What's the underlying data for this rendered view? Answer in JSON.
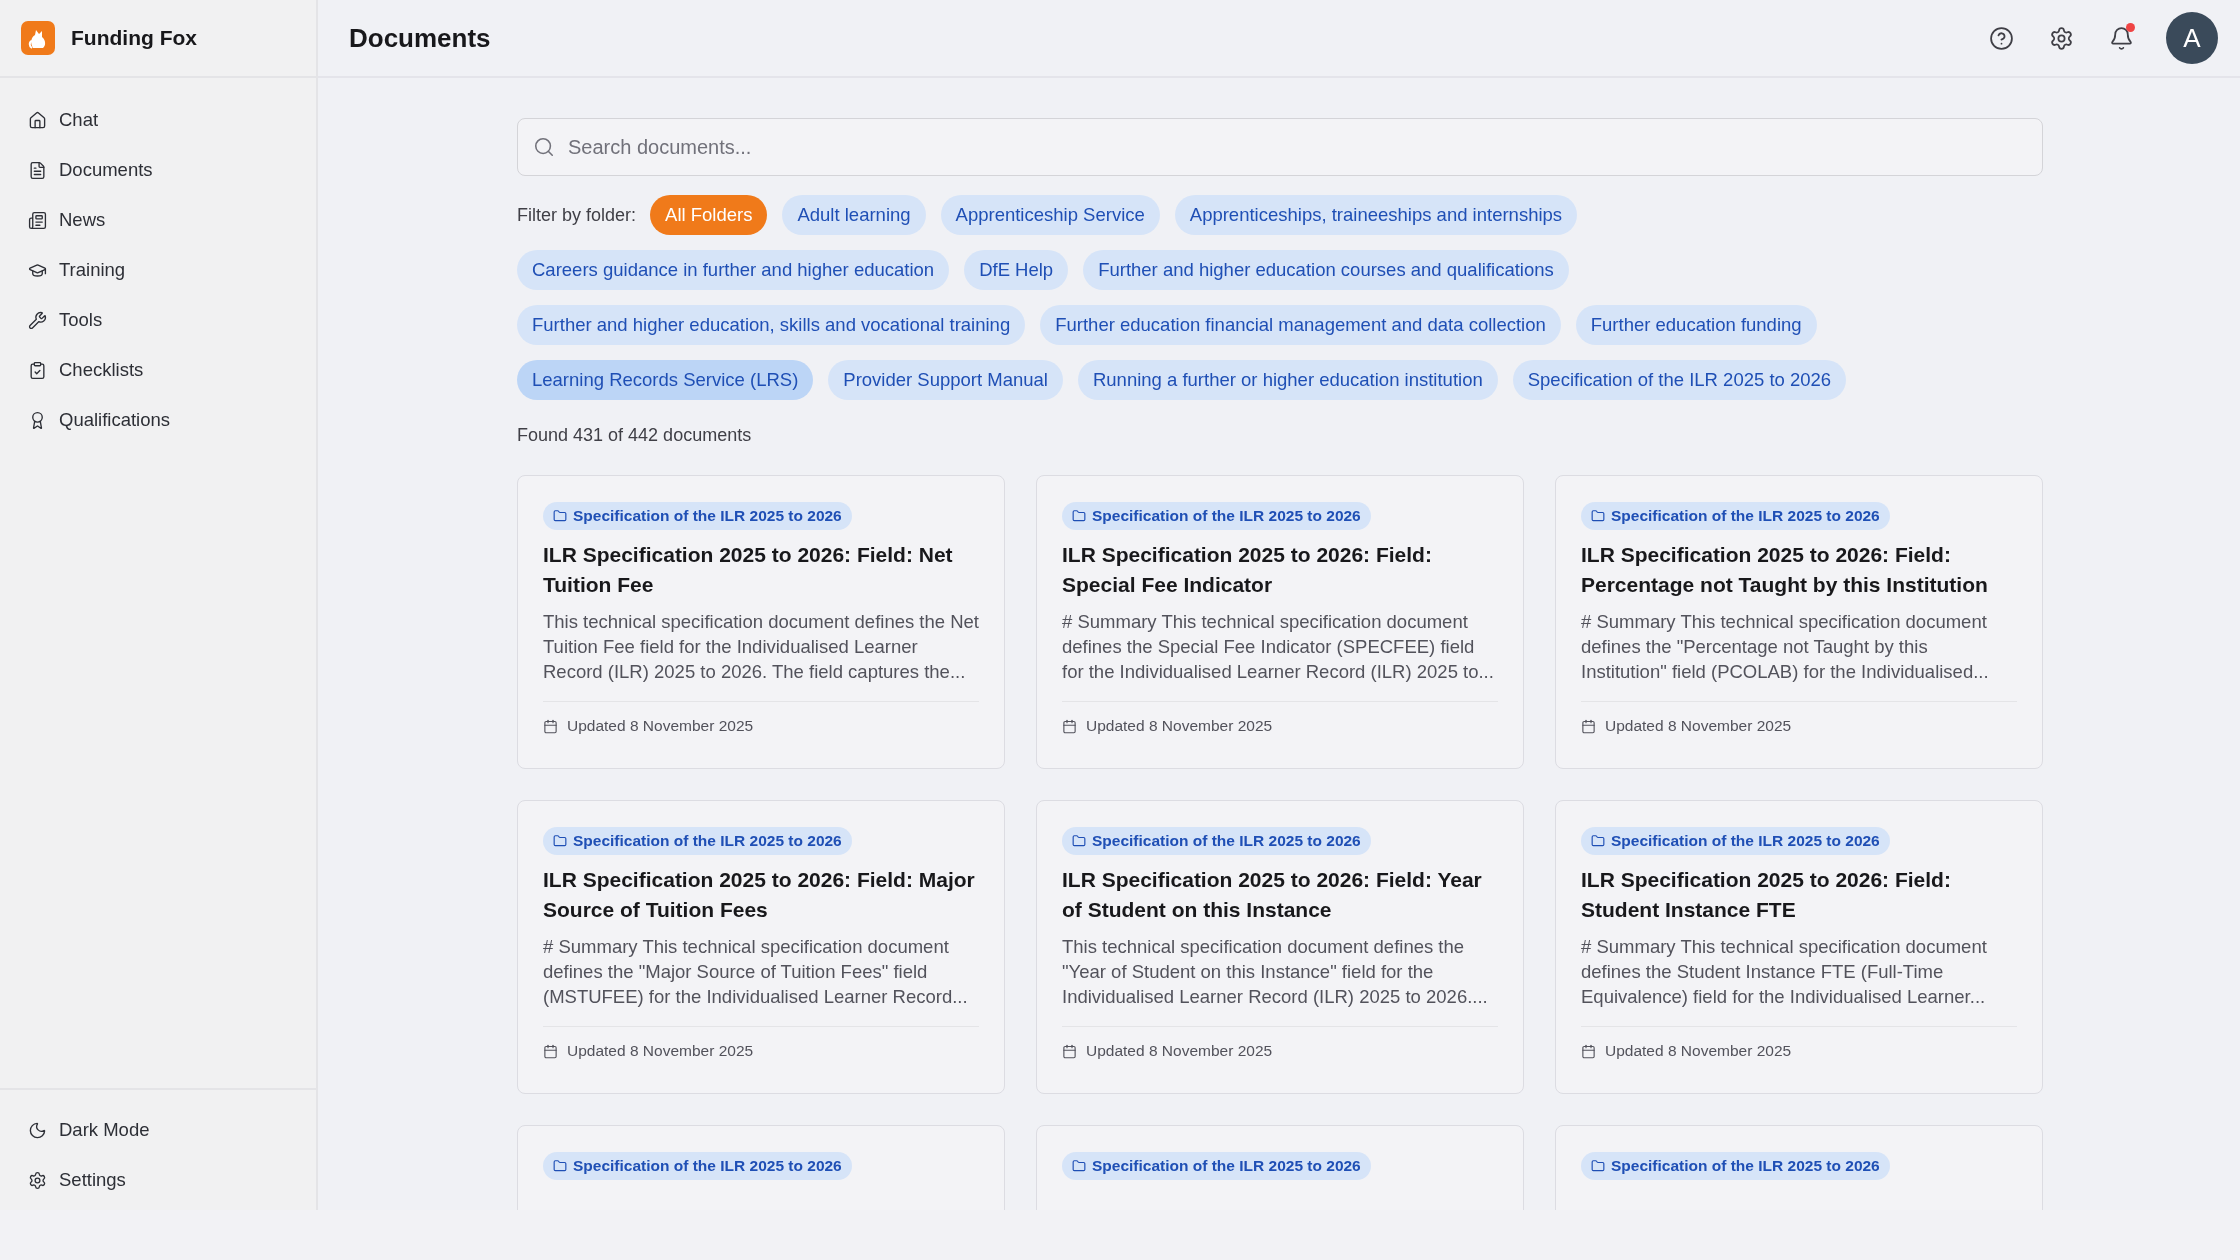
{
  "brand": {
    "name": "Funding Fox"
  },
  "sidebar": {
    "items": [
      {
        "label": "Chat"
      },
      {
        "label": "Documents"
      },
      {
        "label": "News"
      },
      {
        "label": "Training"
      },
      {
        "label": "Tools"
      },
      {
        "label": "Checklists"
      },
      {
        "label": "Qualifications"
      }
    ],
    "footer_items": [
      {
        "label": "Dark Mode"
      },
      {
        "label": "Settings"
      }
    ]
  },
  "header": {
    "title": "Documents",
    "notifications_unread": true,
    "avatar": "A"
  },
  "search": {
    "placeholder": "Search documents..."
  },
  "filter": {
    "label": "Filter by folder:",
    "chips": [
      {
        "label": "All Folders",
        "selected": true,
        "hovered": false
      },
      {
        "label": "Adult learning",
        "selected": false,
        "hovered": false
      },
      {
        "label": "Apprenticeship Service",
        "selected": false,
        "hovered": false
      },
      {
        "label": "Apprenticeships, traineeships and internships",
        "selected": false,
        "hovered": false
      },
      {
        "label": "Careers guidance in further and higher education",
        "selected": false,
        "hovered": false
      },
      {
        "label": "DfE Help",
        "selected": false,
        "hovered": false
      },
      {
        "label": "Further and higher education courses and qualifications",
        "selected": false,
        "hovered": false
      },
      {
        "label": "Further and higher education, skills and vocational training",
        "selected": false,
        "hovered": false
      },
      {
        "label": "Further education financial management and data collection",
        "selected": false,
        "hovered": false
      },
      {
        "label": "Further education funding",
        "selected": false,
        "hovered": false
      },
      {
        "label": "Learning Records Service (LRS)",
        "selected": false,
        "hovered": true
      },
      {
        "label": "Provider Support Manual",
        "selected": false,
        "hovered": false
      },
      {
        "label": "Running a further or higher education institution",
        "selected": false,
        "hovered": false
      },
      {
        "label": "Specification of the ILR 2025 to 2026",
        "selected": false,
        "hovered": false
      }
    ]
  },
  "result_count": "Found 431 of 442 documents",
  "cards": [
    {
      "folder": "Specification of the ILR 2025 to 2026",
      "title": "ILR Specification 2025 to 2026: Field: Net Tuition Fee",
      "description": "This technical specification document defines the Net Tuition Fee field for the Individualised Learner Record (ILR) 2025 to 2026. The field captures the...",
      "updated": "Updated 8 November 2025"
    },
    {
      "folder": "Specification of the ILR 2025 to 2026",
      "title": "ILR Specification 2025 to 2026: Field: Special Fee Indicator",
      "description": "# Summary This technical specification document defines the Special Fee Indicator (SPECFEE) field for the Individualised Learner Record (ILR) 2025 to...",
      "updated": "Updated 8 November 2025"
    },
    {
      "folder": "Specification of the ILR 2025 to 2026",
      "title": "ILR Specification 2025 to 2026: Field: Percentage not Taught by this Institution",
      "description": "# Summary This technical specification document defines the \"Percentage not Taught by this Institution\" field (PCOLAB) for the Individualised...",
      "updated": "Updated 8 November 2025"
    },
    {
      "folder": "Specification of the ILR 2025 to 2026",
      "title": "ILR Specification 2025 to 2026: Field: Major Source of Tuition Fees",
      "description": "# Summary This technical specification document defines the \"Major Source of Tuition Fees\" field (MSTUFEE) for the Individualised Learner Record...",
      "updated": "Updated 8 November 2025"
    },
    {
      "folder": "Specification of the ILR 2025 to 2026",
      "title": "ILR Specification 2025 to 2026: Field: Year of Student on this Instance",
      "description": "This technical specification document defines the \"Year of Student on this Instance\" field for the Individualised Learner Record (ILR) 2025 to 2026....",
      "updated": "Updated 8 November 2025"
    },
    {
      "folder": "Specification of the ILR 2025 to 2026",
      "title": "ILR Specification 2025 to 2026: Field: Student Instance FTE",
      "description": "# Summary This technical specification document defines the Student Instance FTE (Full-Time Equivalence) field for the Individualised Learner...",
      "updated": "Updated 8 November 2025"
    },
    {
      "folder": "Specification of the ILR 2025 to 2026"
    },
    {
      "folder": "Specification of the ILR 2025 to 2026"
    },
    {
      "folder": "Specification of the ILR 2025 to 2026"
    }
  ]
}
